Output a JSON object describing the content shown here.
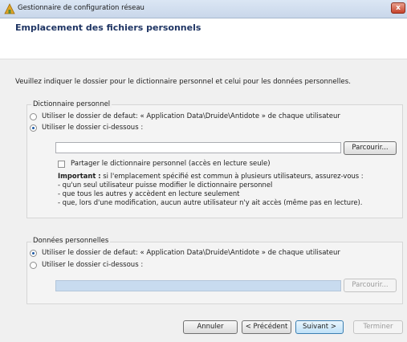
{
  "window": {
    "title": "Gestionnaire de configuration réseau",
    "close_label": "x"
  },
  "header": {
    "title": "Emplacement des fichiers personnels"
  },
  "intro_text": "Veuillez indiquer le dossier pour le dictionnaire personnel et celui pour les données personnelles.",
  "dictionary": {
    "group_label": "Dictionnaire personnel",
    "option_default": "Utiliser le dossier de defaut: « Application Data\\Druide\\Antidote » de chaque utilisateur",
    "option_custom": "Utiliser le dossier ci-dessous :",
    "selected": "custom",
    "path_value": "",
    "browse_label": "Parcourir...",
    "share_label": "Partager le dictionnaire personnel (accès en lecture seule)",
    "share_checked": false,
    "important_label": "Important :",
    "important_text": " si l'emplacement spécifié est commun à plusieurs utilisateurs, assurez-vous :",
    "bullets": [
      "- qu'un seul utilisateur puisse modifier le dictionnaire personnel",
      "- que tous les autres y accèdent en lecture seulement",
      "- que, lors d'une modification, aucun autre utilisateur n'y ait accès (même pas en lecture)."
    ]
  },
  "personal_data": {
    "group_label": "Données personnelles",
    "option_default": "Utiliser le dossier de defaut: « Application Data\\Druide\\Antidote » de chaque utilisateur",
    "option_custom": "Utiliser le dossier ci-dessous :",
    "selected": "default",
    "path_value": "",
    "browse_label": "Parcourir..."
  },
  "footer": {
    "cancel_label": "Annuler",
    "previous_label": "< Précédent",
    "next_label": "Suivant >",
    "finish_label": "Terminer"
  }
}
